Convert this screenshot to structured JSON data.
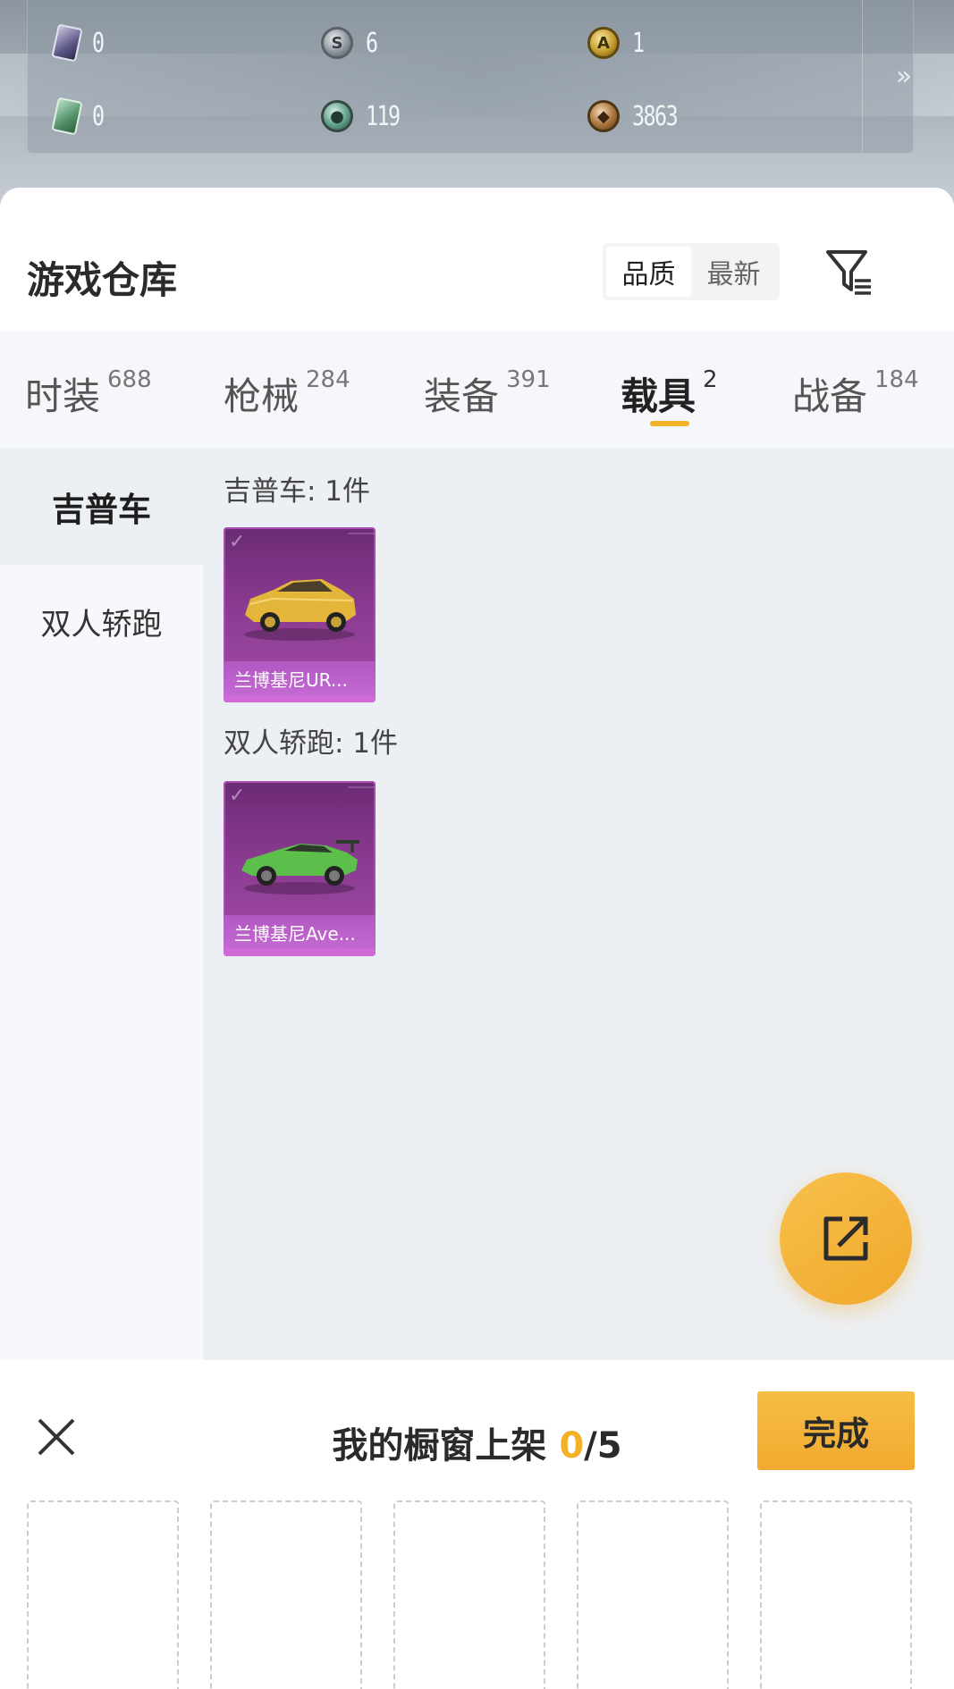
{
  "currencies": [
    {
      "icon": "purple-card-icon",
      "value": "0"
    },
    {
      "icon": "silver-coin-icon",
      "value": "6"
    },
    {
      "icon": "gold-coin-icon",
      "value": "1"
    },
    {
      "icon": "green-card-icon",
      "value": "0"
    },
    {
      "icon": "teal-coin-icon",
      "value": "119"
    },
    {
      "icon": "bronze-coin-icon",
      "value": "3863"
    }
  ],
  "more_icon": "»",
  "header": {
    "title": "游戏仓库",
    "sort_options": [
      "品质",
      "最新"
    ],
    "active_sort": "品质",
    "filter_icon": "filter-icon"
  },
  "tabs": [
    {
      "label": "时装",
      "count": "688"
    },
    {
      "label": "枪械",
      "count": "284"
    },
    {
      "label": "装备",
      "count": "391"
    },
    {
      "label": "载具",
      "count": "2"
    },
    {
      "label": "战备",
      "count": "184"
    }
  ],
  "active_tab": "载具",
  "sidebar": {
    "items": [
      {
        "label": "吉普车"
      },
      {
        "label": "双人轿跑"
      }
    ],
    "active": "吉普车"
  },
  "groups": [
    {
      "title": "吉普车: 1件",
      "items": [
        {
          "name": "兰博基尼UR...",
          "color": "#e8b93a"
        }
      ]
    },
    {
      "title": "双人轿跑: 1件",
      "items": [
        {
          "name": "兰博基尼Ave...",
          "color": "#5fbf4f"
        }
      ]
    }
  ],
  "colors": {
    "accent": "#f3b129",
    "card_purple": "#8a3a90"
  },
  "drawer": {
    "title_prefix": "我的橱窗上架 ",
    "current": "0",
    "total": "/5",
    "done_label": "完成",
    "slot_count": 5
  }
}
